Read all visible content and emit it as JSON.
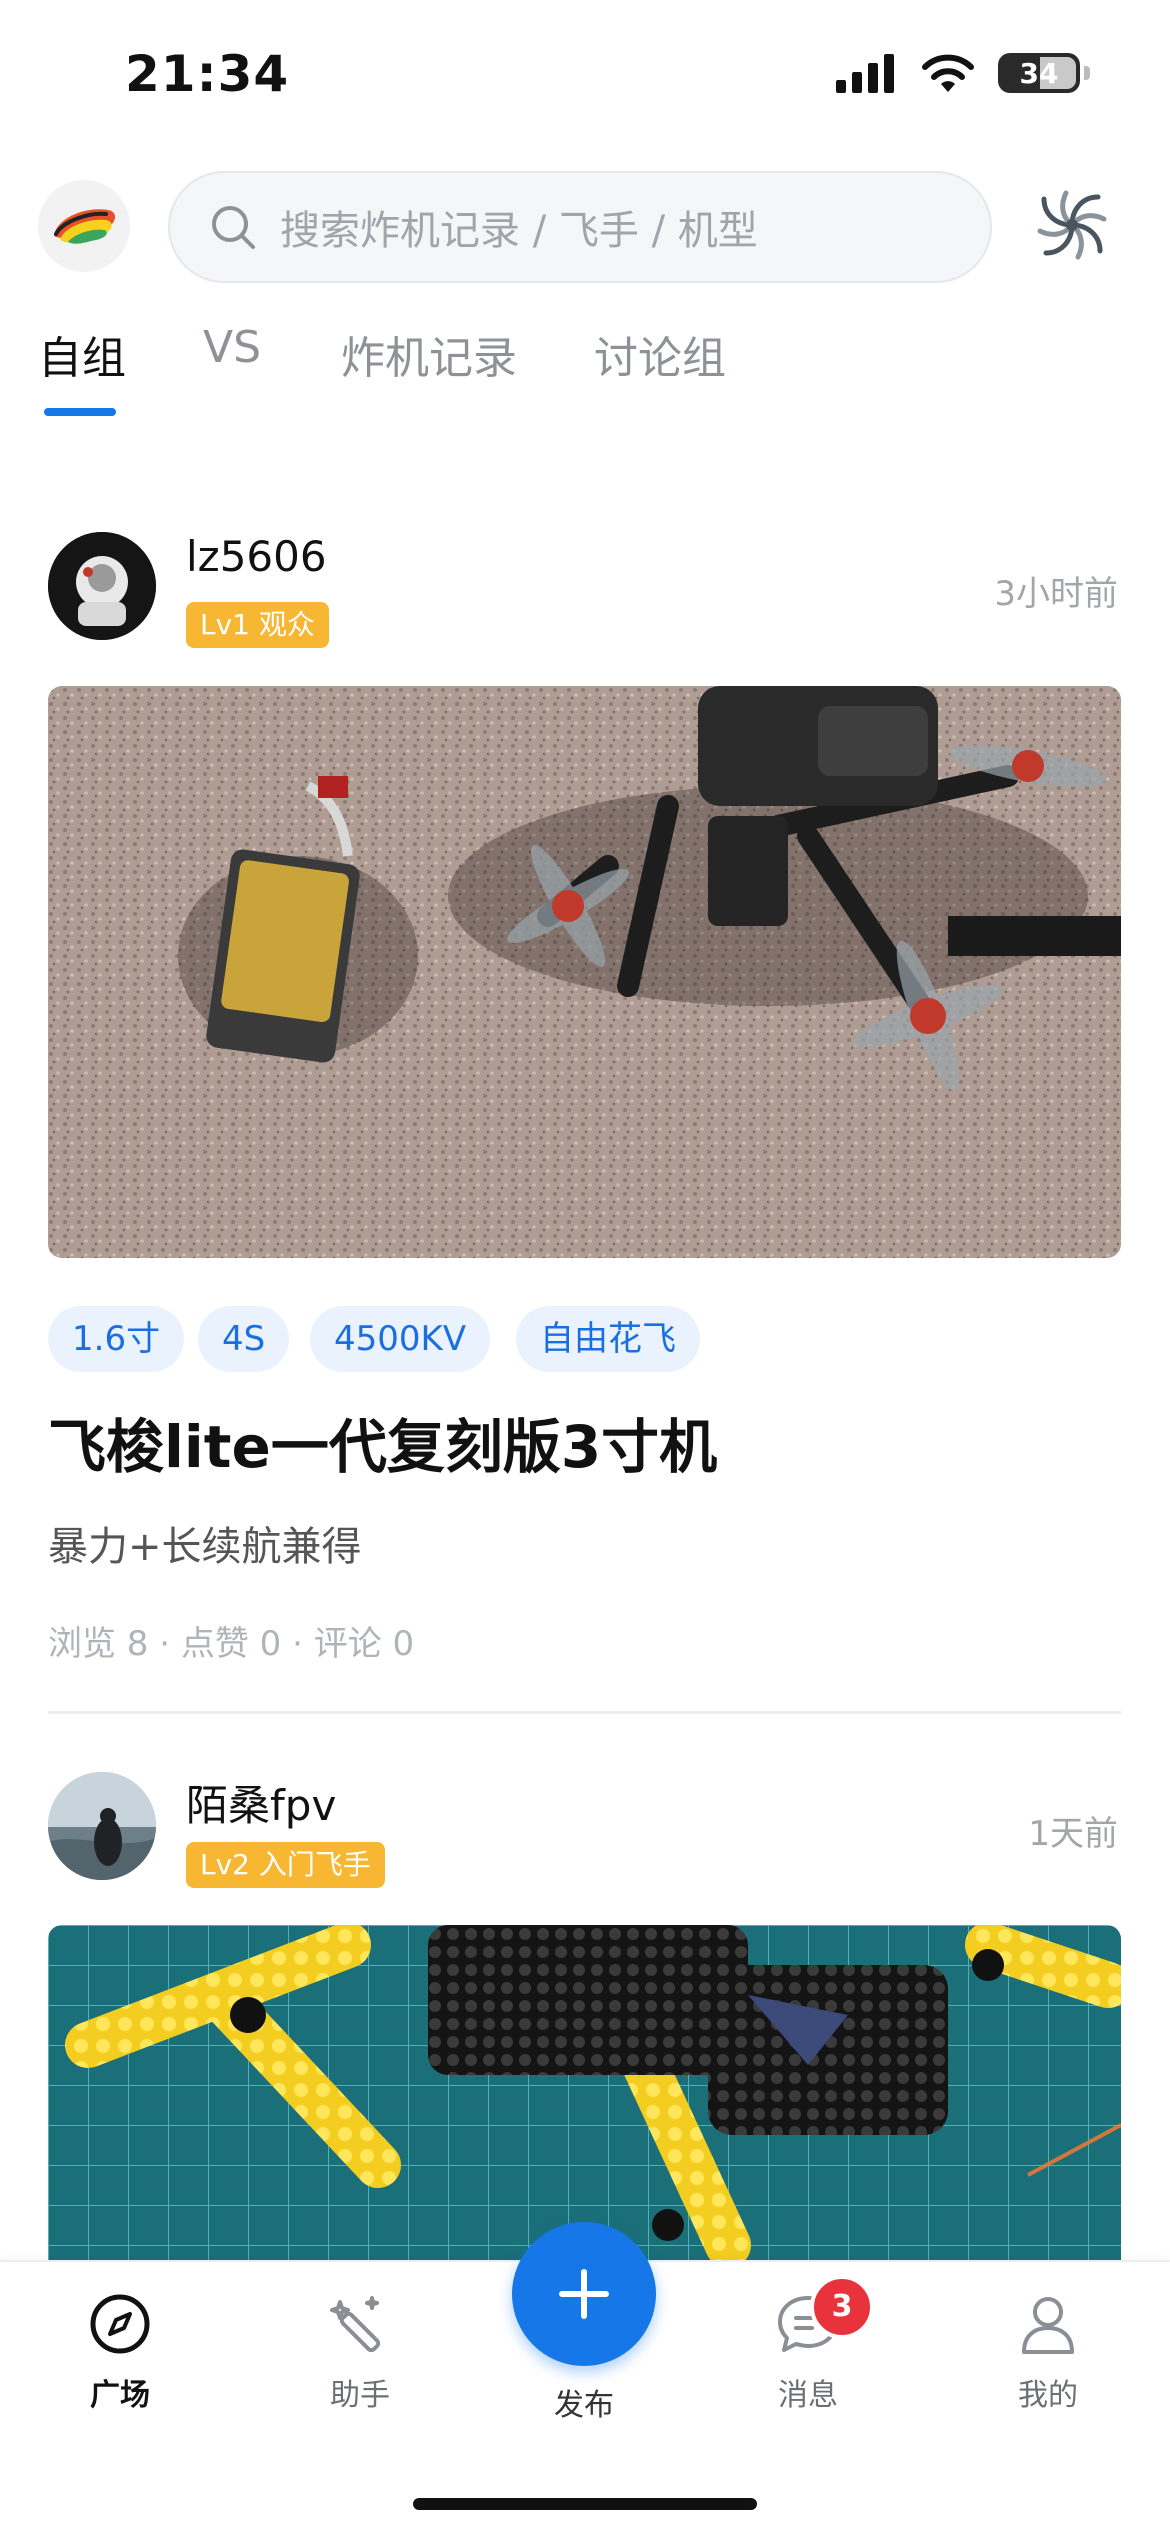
{
  "status_bar": {
    "time": "21:34",
    "battery": "34"
  },
  "search": {
    "placeholder": "搜索炸机记录 / 飞手 / 机型"
  },
  "tabs": [
    {
      "label": "自组",
      "active": true
    },
    {
      "label": "VS"
    },
    {
      "label": "炸机记录"
    },
    {
      "label": "讨论组"
    }
  ],
  "posts": [
    {
      "username": "lz5606",
      "level": "Lv1 观众",
      "time": "3小时前",
      "tags": [
        "1.6寸",
        "4S",
        "4500KV",
        "自由花飞"
      ],
      "title": "飞梭lite一代复刻版3寸机",
      "description": "暴力+长续航兼得",
      "stats": "浏览 8 · 点赞 0 · 评论 0"
    },
    {
      "username": "陌桑fpv",
      "level": "Lv2 入门飞手",
      "time": "1天前"
    }
  ],
  "bottom_nav": {
    "items": [
      {
        "label": "广场",
        "icon": "compass-icon",
        "active": true
      },
      {
        "label": "助手",
        "icon": "magic-wand-icon"
      },
      {
        "label": "发布",
        "icon": "plus-icon"
      },
      {
        "label": "消息",
        "icon": "chat-bubble-icon",
        "badge": "3"
      },
      {
        "label": "我的",
        "icon": "user-icon"
      }
    ]
  },
  "colors": {
    "accent": "#1577e8",
    "level_badge": "#f7b733",
    "tag_bg": "#eaf2fd",
    "notification": "#e8323c"
  }
}
